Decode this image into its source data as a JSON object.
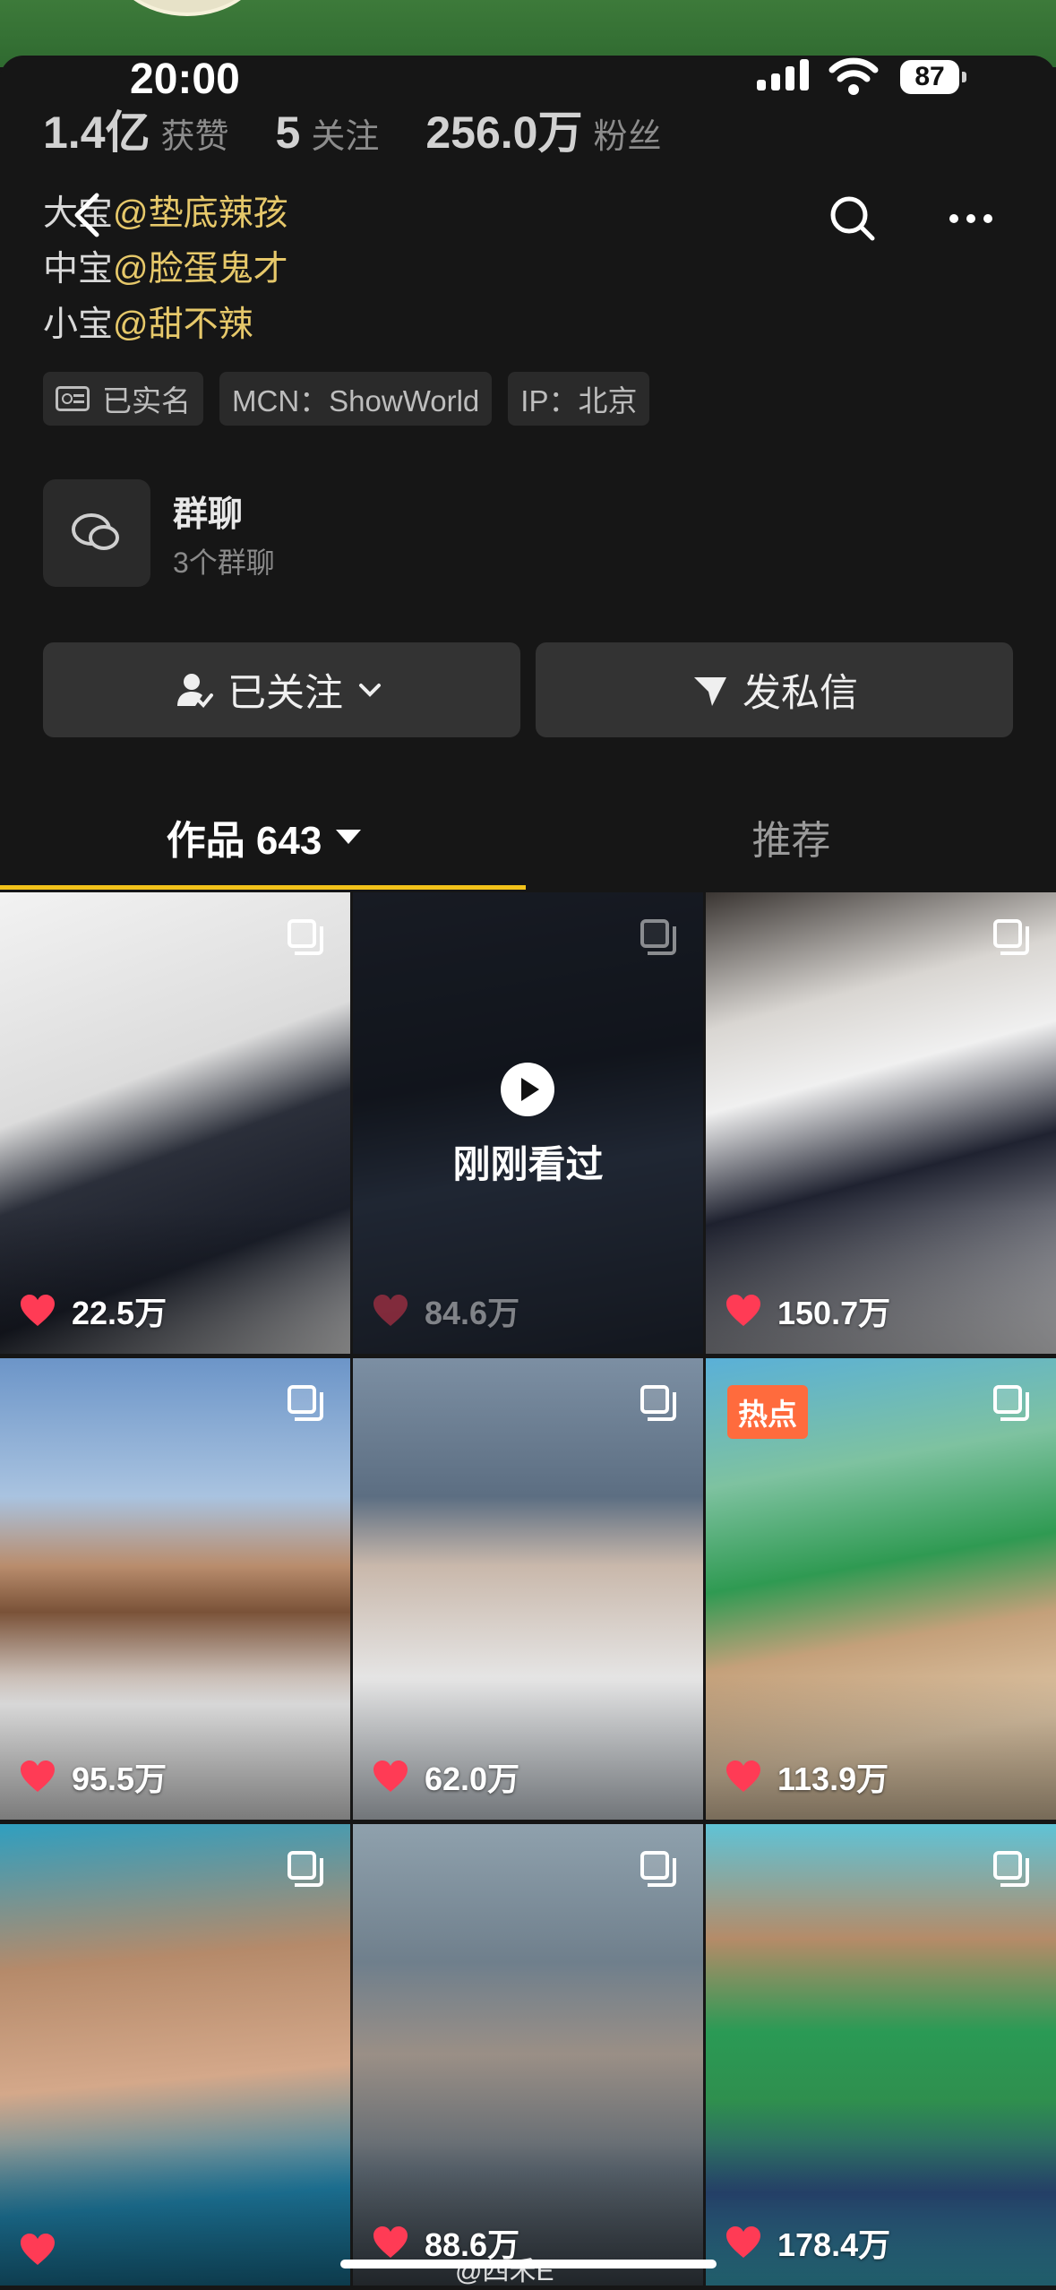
{
  "status_bar": {
    "time": "20:00",
    "battery": "87"
  },
  "stats": [
    {
      "num": "1.4亿",
      "label": "获赞"
    },
    {
      "num": "5",
      "label": "关注"
    },
    {
      "num": "256.0万",
      "label": "粉丝"
    }
  ],
  "bio": [
    {
      "prefix": "大宝",
      "mention": "@垫底辣孩"
    },
    {
      "prefix": "中宝",
      "mention": "@脸蛋鬼才"
    },
    {
      "prefix": "小宝",
      "mention": "@甜不辣"
    }
  ],
  "tags": {
    "verified": "已实名",
    "mcn": "MCN：ShowWorld",
    "ip": "IP：北京"
  },
  "group_chat": {
    "title": "群聊",
    "subtitle": "3个群聊"
  },
  "actions": {
    "follow": "已关注",
    "message": "发私信"
  },
  "tabs": {
    "works": "作品 643",
    "recommend": "推荐"
  },
  "grid": [
    {
      "likes": "22.5万",
      "badge": "",
      "overlay": ""
    },
    {
      "likes": "84.6万",
      "badge": "",
      "overlay": "刚刚看过"
    },
    {
      "likes": "150.7万",
      "badge": "",
      "overlay": ""
    },
    {
      "likes": "95.5万",
      "badge": "",
      "overlay": ""
    },
    {
      "likes": "62.0万",
      "badge": "",
      "overlay": ""
    },
    {
      "likes": "113.9万",
      "badge": "热点",
      "overlay": ""
    },
    {
      "likes": "",
      "badge": "",
      "overlay": ""
    },
    {
      "likes": "88.6万",
      "badge": "",
      "overlay": ""
    },
    {
      "likes": "178.4万",
      "badge": "",
      "overlay": ""
    }
  ],
  "watermark": "@四禾E",
  "colors": {
    "accent": "#f2c21a",
    "mention": "#e6c86a",
    "like": "#ff3b55",
    "hot": "#ff6b3d"
  }
}
